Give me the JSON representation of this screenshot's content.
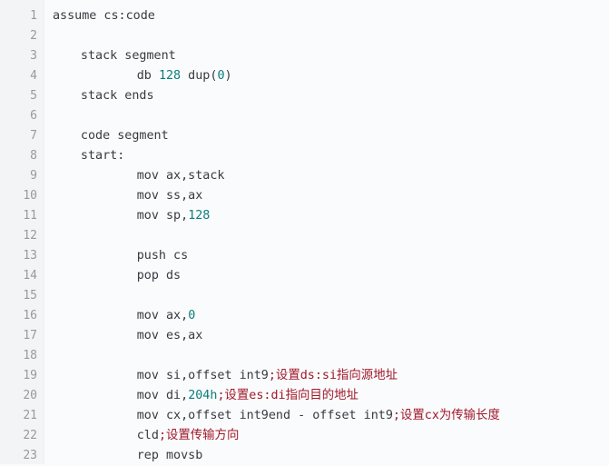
{
  "colors": {
    "background": "#fafbfc",
    "gutter": "#f3f4f6",
    "line_number": "#999999",
    "text": "#383a42",
    "number": "#0e7c7c",
    "comment": "#a0182a"
  },
  "lines": [
    {
      "n": "1",
      "indent": 0,
      "tokens": [
        {
          "t": "text",
          "v": "assume cs:code"
        }
      ]
    },
    {
      "n": "2",
      "indent": 0,
      "tokens": []
    },
    {
      "n": "3",
      "indent": 4,
      "tokens": [
        {
          "t": "text",
          "v": "stack segment"
        }
      ]
    },
    {
      "n": "4",
      "indent": 12,
      "tokens": [
        {
          "t": "text",
          "v": "db "
        },
        {
          "t": "num",
          "v": "128"
        },
        {
          "t": "text",
          "v": " dup("
        },
        {
          "t": "num",
          "v": "0"
        },
        {
          "t": "text",
          "v": ")"
        }
      ]
    },
    {
      "n": "5",
      "indent": 4,
      "tokens": [
        {
          "t": "text",
          "v": "stack ends"
        }
      ]
    },
    {
      "n": "6",
      "indent": 0,
      "tokens": []
    },
    {
      "n": "7",
      "indent": 4,
      "tokens": [
        {
          "t": "text",
          "v": "code segment"
        }
      ]
    },
    {
      "n": "8",
      "indent": 4,
      "tokens": [
        {
          "t": "text",
          "v": "start:"
        }
      ]
    },
    {
      "n": "9",
      "indent": 12,
      "tokens": [
        {
          "t": "text",
          "v": "mov ax,stack"
        }
      ]
    },
    {
      "n": "10",
      "indent": 12,
      "tokens": [
        {
          "t": "text",
          "v": "mov ss,ax"
        }
      ]
    },
    {
      "n": "11",
      "indent": 12,
      "tokens": [
        {
          "t": "text",
          "v": "mov sp,"
        },
        {
          "t": "num",
          "v": "128"
        }
      ]
    },
    {
      "n": "12",
      "indent": 0,
      "tokens": []
    },
    {
      "n": "13",
      "indent": 12,
      "tokens": [
        {
          "t": "text",
          "v": "push cs"
        }
      ]
    },
    {
      "n": "14",
      "indent": 12,
      "tokens": [
        {
          "t": "text",
          "v": "pop ds"
        }
      ]
    },
    {
      "n": "15",
      "indent": 0,
      "tokens": []
    },
    {
      "n": "16",
      "indent": 12,
      "tokens": [
        {
          "t": "text",
          "v": "mov ax,"
        },
        {
          "t": "num",
          "v": "0"
        }
      ]
    },
    {
      "n": "17",
      "indent": 12,
      "tokens": [
        {
          "t": "text",
          "v": "mov es,ax"
        }
      ]
    },
    {
      "n": "18",
      "indent": 0,
      "tokens": []
    },
    {
      "n": "19",
      "indent": 12,
      "tokens": [
        {
          "t": "text",
          "v": "mov si,offset int9"
        },
        {
          "t": "comment",
          "v": ";设置ds:si指向源地址"
        }
      ]
    },
    {
      "n": "20",
      "indent": 12,
      "tokens": [
        {
          "t": "text",
          "v": "mov di,"
        },
        {
          "t": "num",
          "v": "204h"
        },
        {
          "t": "comment",
          "v": ";设置es:di指向目的地址"
        }
      ]
    },
    {
      "n": "21",
      "indent": 12,
      "tokens": [
        {
          "t": "text",
          "v": "mov cx,offset int9end - offset int9"
        },
        {
          "t": "comment",
          "v": ";设置cx为传输长度"
        }
      ]
    },
    {
      "n": "22",
      "indent": 12,
      "tokens": [
        {
          "t": "text",
          "v": "cld"
        },
        {
          "t": "comment",
          "v": ";设置传输方向"
        }
      ]
    },
    {
      "n": "23",
      "indent": 12,
      "tokens": [
        {
          "t": "text",
          "v": "rep movsb"
        }
      ]
    }
  ]
}
